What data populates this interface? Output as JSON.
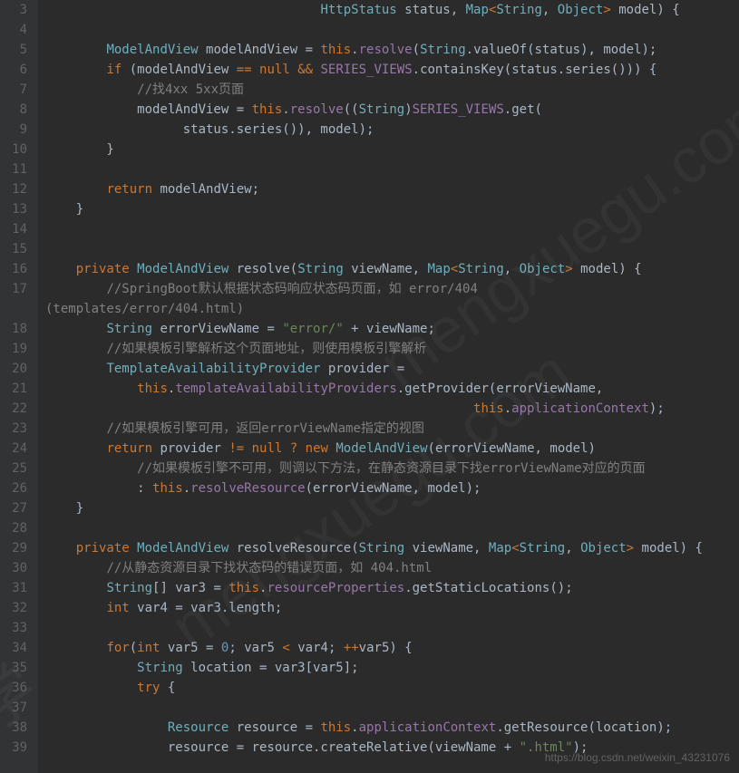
{
  "gutter": {
    "start": 3,
    "end": 39
  },
  "code": {
    "l3": "                                    HttpStatus status, Map<String, Object> model) {",
    "l4": "",
    "l5": "        ModelAndView modelAndView = this.resolve(String.valueOf(status), model);",
    "l6": "        if (modelAndView == null && SERIES_VIEWS.containsKey(status.series())) {",
    "l7": "            //找4xx 5xx页面",
    "l8": "            modelAndView = this.resolve((String)SERIES_VIEWS.get(",
    "l9": "                  status.series()), model);",
    "l10": "        }",
    "l11": "",
    "l12": "        return modelAndView;",
    "l13": "    }",
    "l14": "",
    "l15": "",
    "l16": "    private ModelAndView resolve(String viewName, Map<String, Object> model) {",
    "l17a": "        //SpringBoot默认根据状态码响应状态码页面，如 error/404",
    "l17b": "(templates/error/404.html)",
    "l18": "        String errorViewName = \"error/\" + viewName;",
    "l19": "        //如果模板引擎解析这个页面地址，则使用模板引擎解析",
    "l20": "        TemplateAvailabilityProvider provider =",
    "l21": "            this.templateAvailabilityProviders.getProvider(errorViewName,",
    "l22": "                                                        this.applicationContext);",
    "l23": "        //如果模板引擎可用，返回errorViewName指定的视图",
    "l24": "        return provider != null ? new ModelAndView(errorViewName, model)",
    "l25": "            //如果模板引擎不可用，则调以下方法，在静态资源目录下找errorViewName对应的页面",
    "l26": "            : this.resolveResource(errorViewName, model);",
    "l27": "    }",
    "l28": "",
    "l29": "    private ModelAndView resolveResource(String viewName, Map<String, Object> model) {",
    "l30": "        //从静态资源目录下找状态码的错误页面，如 404.html",
    "l31": "        String[] var3 = this.resourceProperties.getStaticLocations();",
    "l32": "        int var4 = var3.length;",
    "l33": "",
    "l34": "        for(int var5 = 0; var5 < var4; ++var5) {",
    "l35": "            String location = var3[var5];",
    "l36": "            try {",
    "l37": "",
    "l38": "                Resource resource = this.applicationContext.getResource(location);",
    "l39": "                resource = resource.createRelative(viewName + \".html\");"
  },
  "watermarks": {
    "w1": "mengxuegu.com",
    "w2": "mengxuegu.com",
    "w3": "学"
  },
  "footer": "https://blog.csdn.net/weixin_43231076"
}
